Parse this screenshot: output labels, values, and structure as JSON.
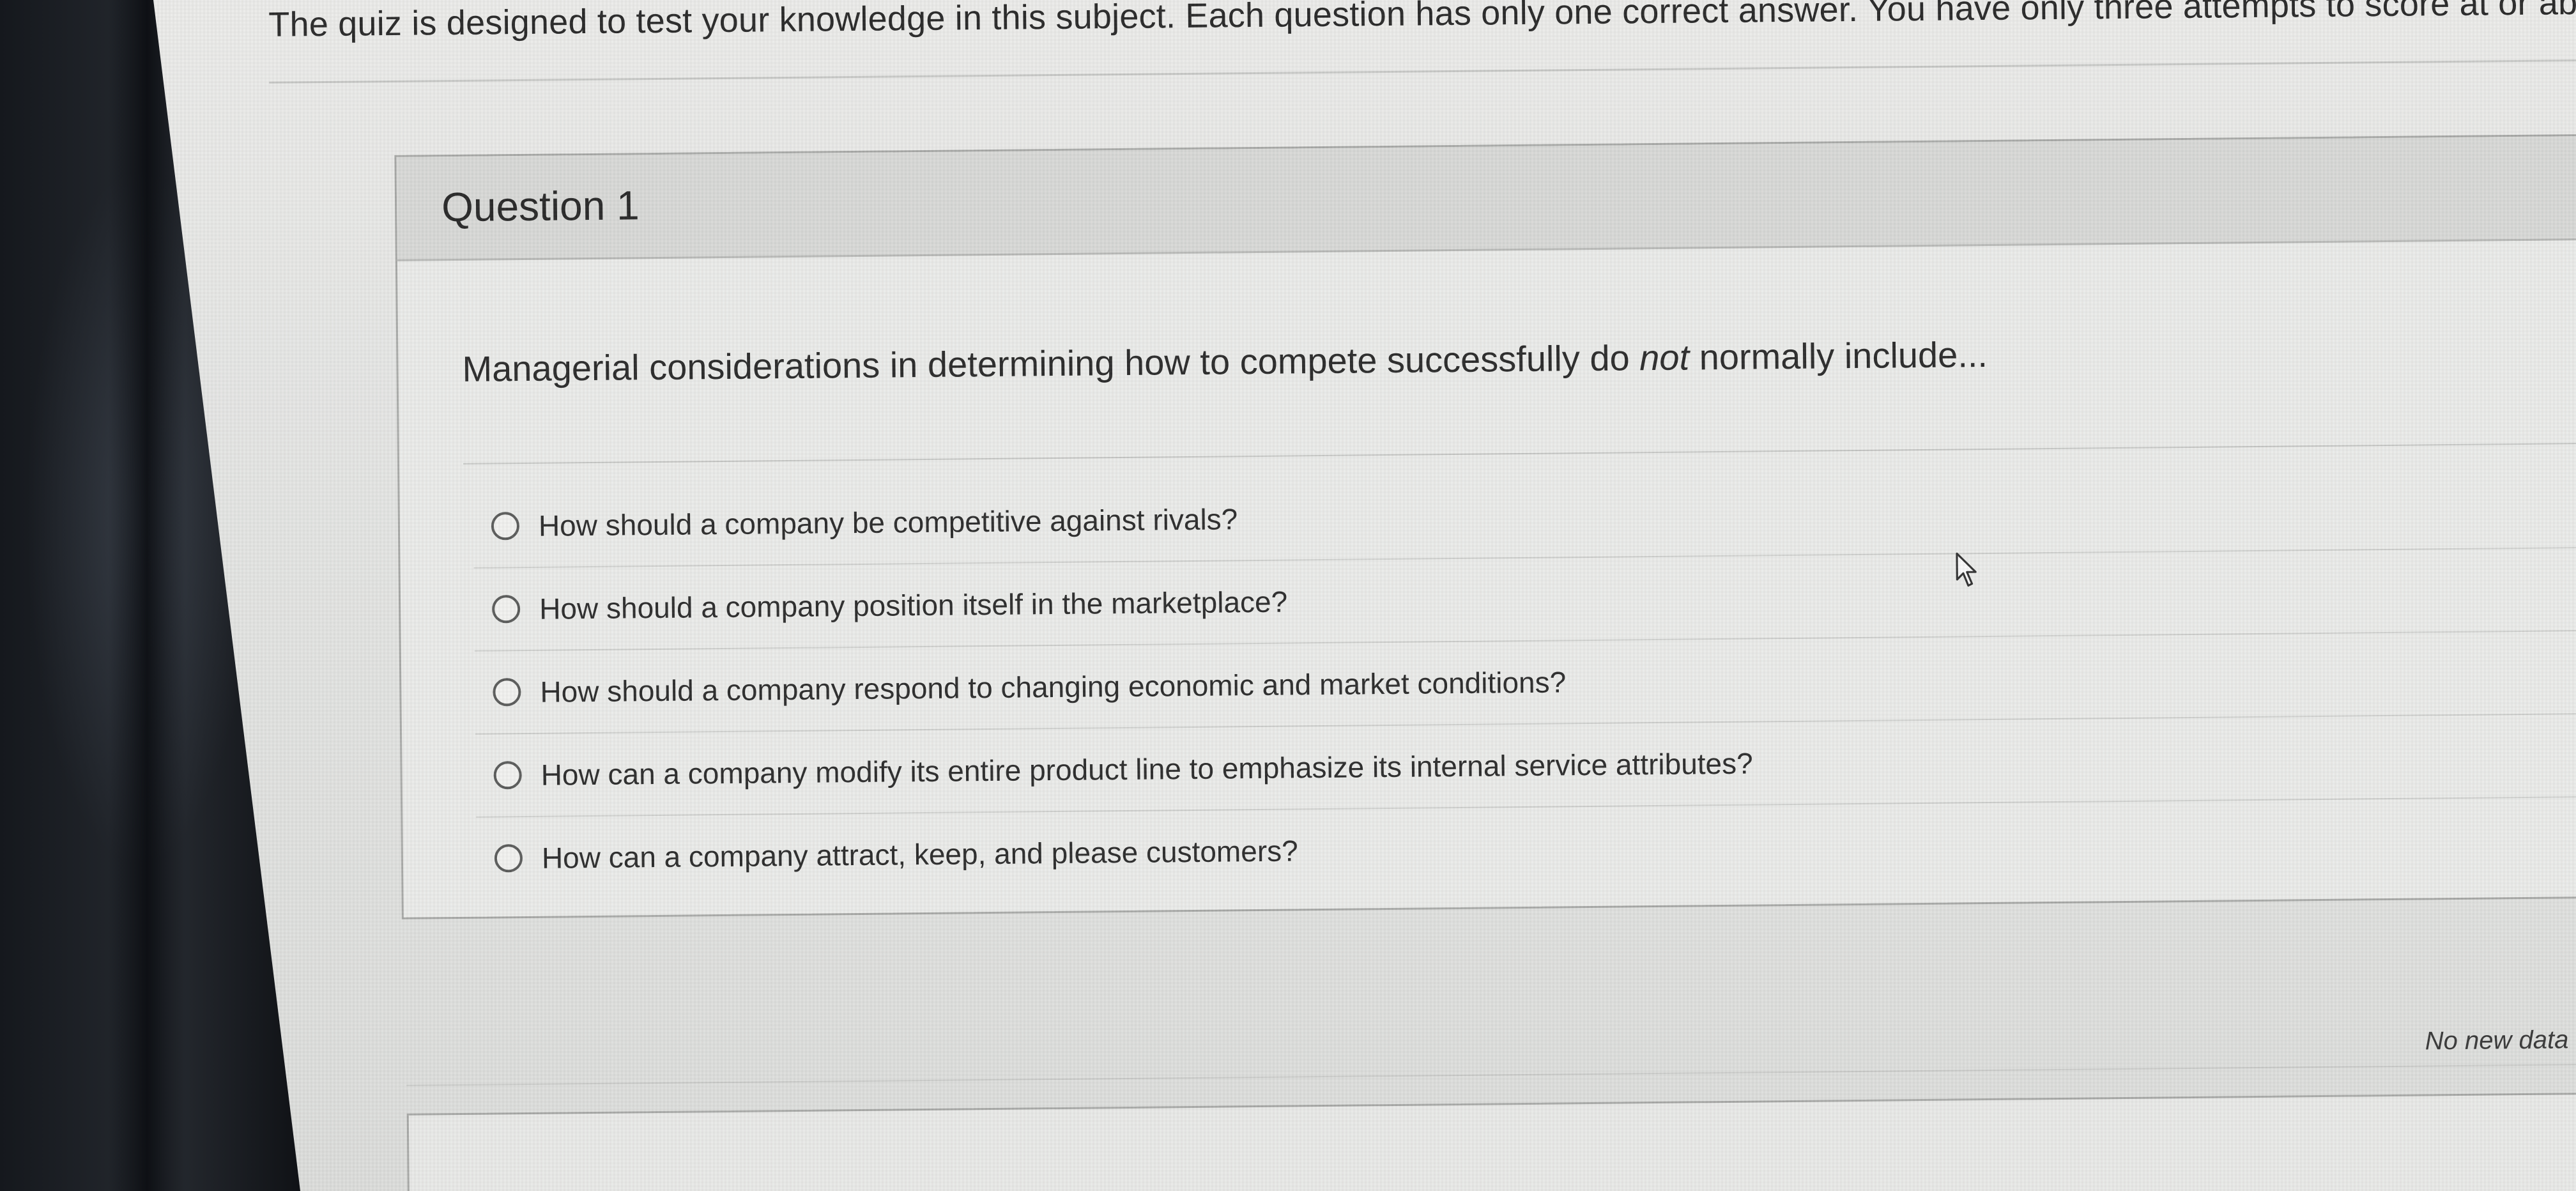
{
  "instructions": {
    "text": "The quiz is designed to test your knowledge in this subject.  Each question has only one correct answer.  You have only three attempts to score at or above"
  },
  "question": {
    "title": "Question 1",
    "prompt_before": "Managerial considerations in determining how to compete successfully do ",
    "prompt_emphasis": "not",
    "prompt_after": " normally include...",
    "answers": [
      {
        "label": "How should a company be competitive against rivals?",
        "selected": false
      },
      {
        "label": "How should a company position itself in the marketplace?",
        "selected": false
      },
      {
        "label": "How should a company respond to changing economic and market conditions?",
        "selected": false
      },
      {
        "label": "How can a company modify its entire product line to emphasize its internal service attributes?",
        "selected": false
      },
      {
        "label": "How can a company attract, keep, and please customers?",
        "selected": false
      }
    ]
  },
  "status": {
    "text": "No new data"
  },
  "icons": {
    "cursor": "mouse-pointer-icon",
    "radio": "radio-button-icon"
  }
}
